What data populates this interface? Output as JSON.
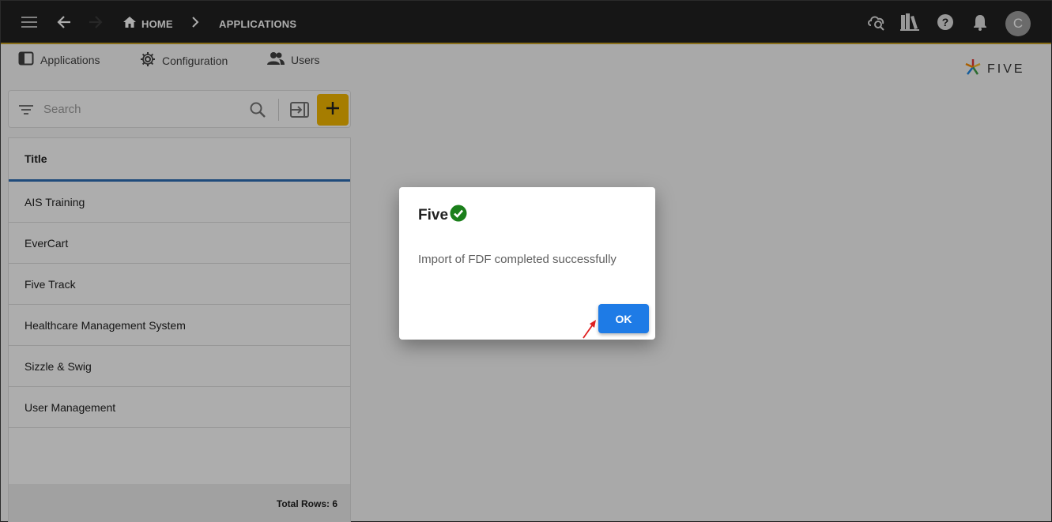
{
  "topbar": {
    "breadcrumb_home": "HOME",
    "breadcrumb_current": "APPLICATIONS",
    "avatar_initial": "C",
    "icons": [
      "menu-icon",
      "back-arrow-icon",
      "forward-arrow-icon",
      "home-icon",
      "chevron-right-icon",
      "cloud-search-icon",
      "library-books-icon",
      "help-icon",
      "notification-bell-icon"
    ]
  },
  "menu": {
    "items": [
      {
        "label": "Applications",
        "icon": "application-panel-icon"
      },
      {
        "label": "Configuration",
        "icon": "gear-icon"
      },
      {
        "label": "Users",
        "icon": "users-icon"
      }
    ]
  },
  "logo": {
    "text": "FIVE"
  },
  "search": {
    "placeholder": "Search"
  },
  "list": {
    "header": "Title",
    "rows": [
      "AIS Training",
      "EverCart",
      "Five Track",
      "Healthcare Management System",
      "Sizzle & Swig",
      "User Management"
    ],
    "footer": "Total Rows: 6"
  },
  "dialog": {
    "title": "Five",
    "message": "Import of FDF completed successfully",
    "ok_label": "OK"
  },
  "colors": {
    "topbar": "#212121",
    "accent_gold": "#f5b800",
    "header_underline": "#2f6fb5",
    "ok_button": "#1e7be6",
    "success_check": "#1b7f1b",
    "pointer": "#e02020"
  }
}
